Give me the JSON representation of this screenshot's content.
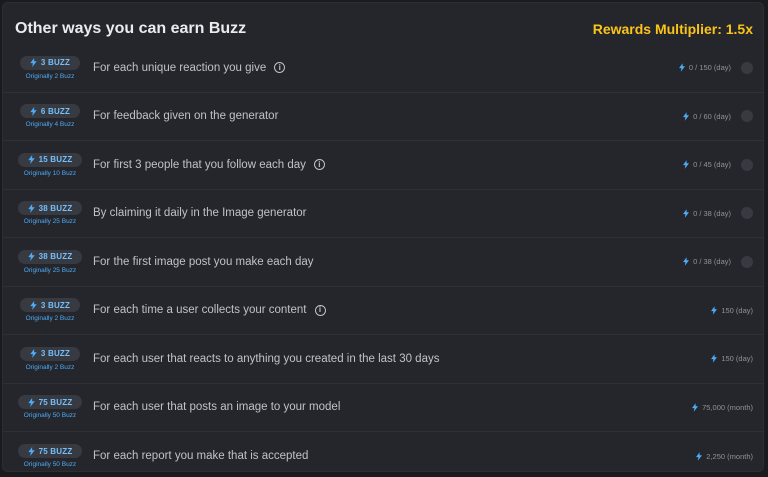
{
  "header": {
    "title": "Other ways you can earn Buzz",
    "multiplier": "Rewards Multiplier: 1.5x"
  },
  "colors": {
    "accent": "#74c0fc",
    "multiplier": "#fcc419",
    "background": "#25262b"
  },
  "rows": [
    {
      "buzz": "3 BUZZ",
      "original": "Originally 2 Buzz",
      "description": "For each unique reaction you give",
      "info": true,
      "progress": "0 / 150 (day)",
      "indicator": true
    },
    {
      "buzz": "6 BUZZ",
      "original": "Originally 4 Buzz",
      "description": "For feedback given on the generator",
      "info": false,
      "progress": "0 / 60 (day)",
      "indicator": true
    },
    {
      "buzz": "15 BUZZ",
      "original": "Originally 10 Buzz",
      "description": "For first 3 people that you follow each day",
      "info": true,
      "progress": "0 / 45 (day)",
      "indicator": true
    },
    {
      "buzz": "38 BUZZ",
      "original": "Originally 25 Buzz",
      "description": "By claiming it daily in the Image generator",
      "info": false,
      "progress": "0 / 38 (day)",
      "indicator": true
    },
    {
      "buzz": "38 BUZZ",
      "original": "Originally 25 Buzz",
      "description": "For the first image post you make each day",
      "info": false,
      "progress": "0 / 38 (day)",
      "indicator": true
    },
    {
      "buzz": "3 BUZZ",
      "original": "Originally 2 Buzz",
      "description": "For each time a user collects your content",
      "info": true,
      "progress": "150 (day)",
      "indicator": false
    },
    {
      "buzz": "3 BUZZ",
      "original": "Originally 2 Buzz",
      "description": "For each user that reacts to anything you created in the last 30 days",
      "info": false,
      "progress": "150 (day)",
      "indicator": false
    },
    {
      "buzz": "75 BUZZ",
      "original": "Originally 50 Buzz",
      "description": "For each user that posts an image to your model",
      "info": false,
      "progress": "75,000 (month)",
      "indicator": false
    },
    {
      "buzz": "75 BUZZ",
      "original": "Originally 50 Buzz",
      "description": "For each report you make that is accepted",
      "info": false,
      "progress": "2,250 (month)",
      "indicator": false
    }
  ]
}
